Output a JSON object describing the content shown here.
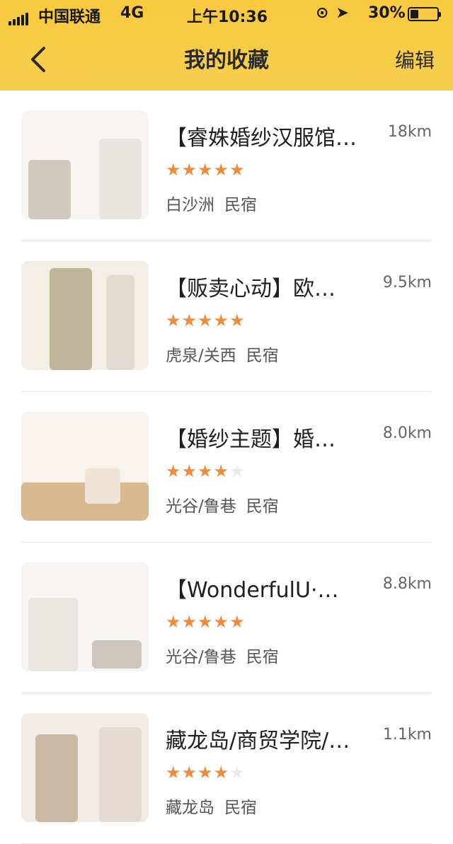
{
  "status_bar": {
    "carrier": "中国联通",
    "network": "4G",
    "time": "上午10:36",
    "battery_text": "30%",
    "battery_level": 0.3,
    "lock_icon": "⊙",
    "location_icon": "➤"
  },
  "nav": {
    "back_icon": "chevron-left-icon",
    "title": "我的收藏",
    "edit_label": "编辑"
  },
  "favorites": [
    {
      "title": "【睿姝婚纱汉服馆…",
      "distance": "18km",
      "rating": 5,
      "area": "白沙洲",
      "type": "民宿",
      "thumb_colors": [
        "#e9e6e1",
        "#f6f5f2",
        "#cfc9bf"
      ]
    },
    {
      "title": "【贩卖心动】欧…",
      "distance": "9.5km",
      "rating": 5,
      "area": "虎泉/关西",
      "type": "民宿",
      "thumb_colors": [
        "#dfd9cf",
        "#f3efe7",
        "#bfb39a"
      ]
    },
    {
      "title": "【婚纱主题】婚…",
      "distance": "8.0km",
      "rating": 4,
      "area": "光谷/鲁巷",
      "type": "民宿",
      "thumb_colors": [
        "#efe4d6",
        "#f7f2ec",
        "#d9b98f"
      ]
    },
    {
      "title": "【WonderfulU·…",
      "distance": "8.8km",
      "rating": 5,
      "area": "光谷/鲁巷",
      "type": "民宿",
      "thumb_colors": [
        "#eae7e3",
        "#f6f5f3",
        "#cdc6bd"
      ]
    },
    {
      "title": "藏龙岛/商贸学院/…",
      "distance": "1.1km",
      "rating": 4,
      "area": "藏龙岛",
      "type": "民宿",
      "thumb_colors": [
        "#e4dbd3",
        "#f1ece6",
        "#c9b8a6"
      ]
    }
  ]
}
